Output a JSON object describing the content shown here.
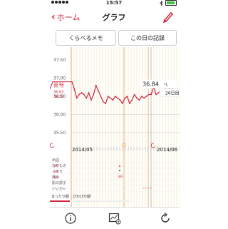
{
  "status_bar": {
    "time": "15:57"
  },
  "nav": {
    "back_label": "ホーム",
    "title": "グラフ"
  },
  "buttons": {
    "compare_memo": "くらべるメモ",
    "day_record": "この日の記録"
  },
  "chart_data": {
    "type": "line",
    "y_ticks": [
      "37.50",
      "37.00",
      "36.50",
      "36.00",
      "35.50"
    ],
    "y_ticks_overlap": [
      "36.84",
      "36.79",
      "36.63",
      "36.50"
    ],
    "ylim": [
      35.3,
      37.7
    ],
    "x_labels": [
      "2014/05",
      "2014/06"
    ],
    "series": [
      {
        "values": [
          36.9,
          36.7,
          36.45,
          36.55,
          36.6,
          36.55,
          36.45,
          36.6,
          36.4,
          36.55,
          36.8,
          36.65,
          36.5,
          36.35,
          36.3,
          36.5,
          36.45,
          36.4,
          36.5,
          36.45,
          36.4,
          36.3,
          36.45,
          36.5,
          36.3,
          36.4,
          36.55,
          36.45,
          36.4,
          36.5,
          36.45,
          36.5,
          36.55,
          36.55,
          36.75,
          36.55,
          36.6,
          36.65,
          36.55,
          36.7,
          36.6,
          36.84,
          36.7,
          36.55
        ]
      }
    ],
    "tooltip": {
      "value": "36.84",
      "unit": "°C",
      "day": "26日目"
    },
    "row_labels": [
      "出血",
      "おりもの",
      "くすり",
      "痛み",
      "肌の調子",
      "いいかい"
    ],
    "phase_labels": [
      "まったり期",
      "ぴかぴか期"
    ],
    "colors": {
      "accent": "#d0263b",
      "grid": "#ecdca5",
      "vline": "#f1a05a"
    }
  }
}
